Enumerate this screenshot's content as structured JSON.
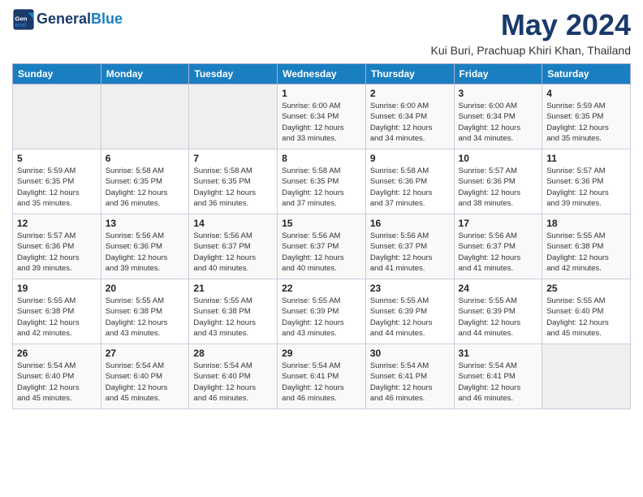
{
  "header": {
    "logo_line1": "General",
    "logo_line2": "Blue",
    "month": "May 2024",
    "location": "Kui Buri, Prachuap Khiri Khan, Thailand"
  },
  "days_of_week": [
    "Sunday",
    "Monday",
    "Tuesday",
    "Wednesday",
    "Thursday",
    "Friday",
    "Saturday"
  ],
  "weeks": [
    [
      {
        "num": "",
        "info": "",
        "empty": true
      },
      {
        "num": "",
        "info": "",
        "empty": true
      },
      {
        "num": "",
        "info": "",
        "empty": true
      },
      {
        "num": "1",
        "info": "Sunrise: 6:00 AM\nSunset: 6:34 PM\nDaylight: 12 hours\nand 33 minutes.",
        "empty": false
      },
      {
        "num": "2",
        "info": "Sunrise: 6:00 AM\nSunset: 6:34 PM\nDaylight: 12 hours\nand 34 minutes.",
        "empty": false
      },
      {
        "num": "3",
        "info": "Sunrise: 6:00 AM\nSunset: 6:34 PM\nDaylight: 12 hours\nand 34 minutes.",
        "empty": false
      },
      {
        "num": "4",
        "info": "Sunrise: 5:59 AM\nSunset: 6:35 PM\nDaylight: 12 hours\nand 35 minutes.",
        "empty": false
      }
    ],
    [
      {
        "num": "5",
        "info": "Sunrise: 5:59 AM\nSunset: 6:35 PM\nDaylight: 12 hours\nand 35 minutes.",
        "empty": false
      },
      {
        "num": "6",
        "info": "Sunrise: 5:58 AM\nSunset: 6:35 PM\nDaylight: 12 hours\nand 36 minutes.",
        "empty": false
      },
      {
        "num": "7",
        "info": "Sunrise: 5:58 AM\nSunset: 6:35 PM\nDaylight: 12 hours\nand 36 minutes.",
        "empty": false
      },
      {
        "num": "8",
        "info": "Sunrise: 5:58 AM\nSunset: 6:35 PM\nDaylight: 12 hours\nand 37 minutes.",
        "empty": false
      },
      {
        "num": "9",
        "info": "Sunrise: 5:58 AM\nSunset: 6:36 PM\nDaylight: 12 hours\nand 37 minutes.",
        "empty": false
      },
      {
        "num": "10",
        "info": "Sunrise: 5:57 AM\nSunset: 6:36 PM\nDaylight: 12 hours\nand 38 minutes.",
        "empty": false
      },
      {
        "num": "11",
        "info": "Sunrise: 5:57 AM\nSunset: 6:36 PM\nDaylight: 12 hours\nand 39 minutes.",
        "empty": false
      }
    ],
    [
      {
        "num": "12",
        "info": "Sunrise: 5:57 AM\nSunset: 6:36 PM\nDaylight: 12 hours\nand 39 minutes.",
        "empty": false
      },
      {
        "num": "13",
        "info": "Sunrise: 5:56 AM\nSunset: 6:36 PM\nDaylight: 12 hours\nand 39 minutes.",
        "empty": false
      },
      {
        "num": "14",
        "info": "Sunrise: 5:56 AM\nSunset: 6:37 PM\nDaylight: 12 hours\nand 40 minutes.",
        "empty": false
      },
      {
        "num": "15",
        "info": "Sunrise: 5:56 AM\nSunset: 6:37 PM\nDaylight: 12 hours\nand 40 minutes.",
        "empty": false
      },
      {
        "num": "16",
        "info": "Sunrise: 5:56 AM\nSunset: 6:37 PM\nDaylight: 12 hours\nand 41 minutes.",
        "empty": false
      },
      {
        "num": "17",
        "info": "Sunrise: 5:56 AM\nSunset: 6:37 PM\nDaylight: 12 hours\nand 41 minutes.",
        "empty": false
      },
      {
        "num": "18",
        "info": "Sunrise: 5:55 AM\nSunset: 6:38 PM\nDaylight: 12 hours\nand 42 minutes.",
        "empty": false
      }
    ],
    [
      {
        "num": "19",
        "info": "Sunrise: 5:55 AM\nSunset: 6:38 PM\nDaylight: 12 hours\nand 42 minutes.",
        "empty": false
      },
      {
        "num": "20",
        "info": "Sunrise: 5:55 AM\nSunset: 6:38 PM\nDaylight: 12 hours\nand 43 minutes.",
        "empty": false
      },
      {
        "num": "21",
        "info": "Sunrise: 5:55 AM\nSunset: 6:38 PM\nDaylight: 12 hours\nand 43 minutes.",
        "empty": false
      },
      {
        "num": "22",
        "info": "Sunrise: 5:55 AM\nSunset: 6:39 PM\nDaylight: 12 hours\nand 43 minutes.",
        "empty": false
      },
      {
        "num": "23",
        "info": "Sunrise: 5:55 AM\nSunset: 6:39 PM\nDaylight: 12 hours\nand 44 minutes.",
        "empty": false
      },
      {
        "num": "24",
        "info": "Sunrise: 5:55 AM\nSunset: 6:39 PM\nDaylight: 12 hours\nand 44 minutes.",
        "empty": false
      },
      {
        "num": "25",
        "info": "Sunrise: 5:55 AM\nSunset: 6:40 PM\nDaylight: 12 hours\nand 45 minutes.",
        "empty": false
      }
    ],
    [
      {
        "num": "26",
        "info": "Sunrise: 5:54 AM\nSunset: 6:40 PM\nDaylight: 12 hours\nand 45 minutes.",
        "empty": false
      },
      {
        "num": "27",
        "info": "Sunrise: 5:54 AM\nSunset: 6:40 PM\nDaylight: 12 hours\nand 45 minutes.",
        "empty": false
      },
      {
        "num": "28",
        "info": "Sunrise: 5:54 AM\nSunset: 6:40 PM\nDaylight: 12 hours\nand 46 minutes.",
        "empty": false
      },
      {
        "num": "29",
        "info": "Sunrise: 5:54 AM\nSunset: 6:41 PM\nDaylight: 12 hours\nand 46 minutes.",
        "empty": false
      },
      {
        "num": "30",
        "info": "Sunrise: 5:54 AM\nSunset: 6:41 PM\nDaylight: 12 hours\nand 46 minutes.",
        "empty": false
      },
      {
        "num": "31",
        "info": "Sunrise: 5:54 AM\nSunset: 6:41 PM\nDaylight: 12 hours\nand 46 minutes.",
        "empty": false
      },
      {
        "num": "",
        "info": "",
        "empty": true
      }
    ]
  ]
}
